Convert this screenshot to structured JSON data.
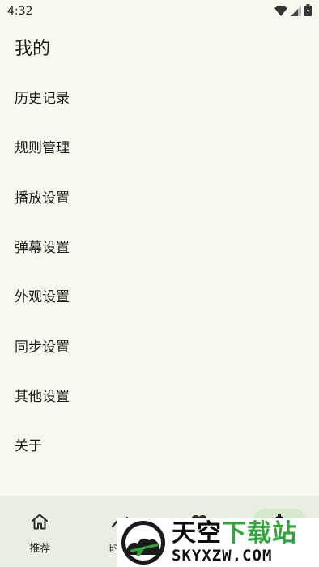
{
  "status_bar": {
    "time": "4:32",
    "icons": [
      "wifi-icon",
      "cell-signal-icon",
      "battery-icon"
    ]
  },
  "page": {
    "title": "我的"
  },
  "menu": {
    "items": [
      {
        "label": "历史记录"
      },
      {
        "label": "规则管理"
      },
      {
        "label": "播放设置"
      },
      {
        "label": "弹幕设置"
      },
      {
        "label": "外观设置"
      },
      {
        "label": "同步设置"
      },
      {
        "label": "其他设置"
      },
      {
        "label": "关于"
      }
    ]
  },
  "bottom_nav": {
    "items": [
      {
        "label": "推荐",
        "icon": "home-icon"
      },
      {
        "label": "时间",
        "icon": "timeline-icon"
      },
      {
        "label": "",
        "icon": "heart-icon"
      },
      {
        "label": "",
        "icon": "settings-icon",
        "selected": true
      }
    ]
  },
  "watermark": {
    "line1_black": "天空",
    "line1_green": "下载站",
    "line2": "SKYXZW.COM"
  },
  "colors": {
    "background": "#f5f9f0",
    "nav_background": "#e9eee3",
    "nav_indicator": "#d6e8cc",
    "watermark_green": "#2fa53b"
  }
}
